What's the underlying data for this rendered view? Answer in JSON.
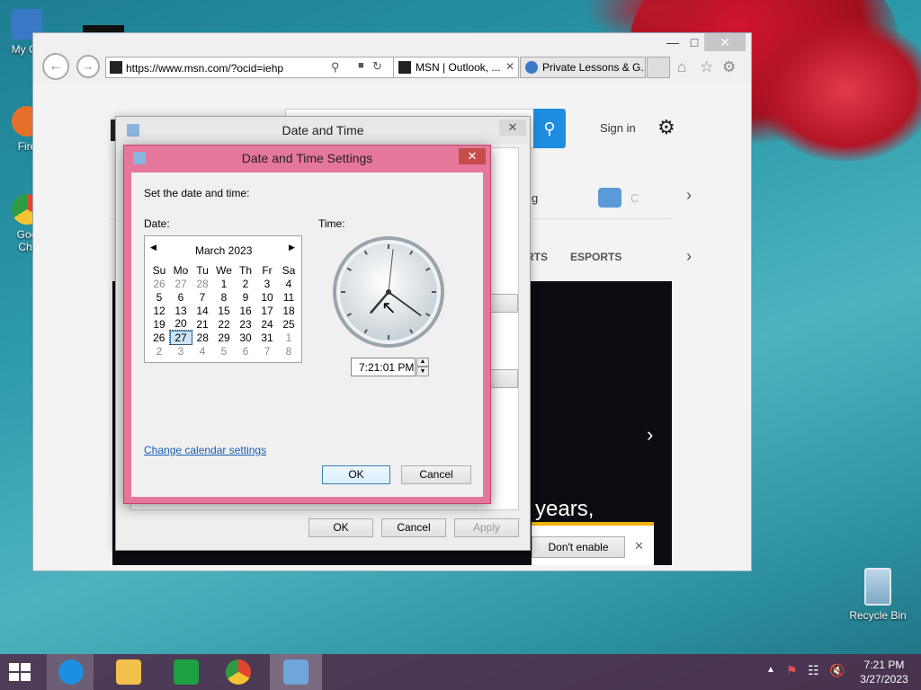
{
  "desktop": {
    "icons": [
      {
        "label": "My Co",
        "color": "#3a78c8"
      },
      {
        "label": "Fire",
        "color": "#e76f2a"
      },
      {
        "label": "Goo Chr",
        "color": "#2f9c44"
      }
    ],
    "recycle_bin": {
      "label": "Recycle Bin"
    }
  },
  "browser": {
    "url": "https://www.msn.com/?ocid=iehp",
    "tabs": [
      {
        "label": "MSN | Outlook, ...",
        "active": true
      },
      {
        "label": "Private Lessons & G...",
        "active": false
      }
    ],
    "page": {
      "sign_in": "Sign in",
      "nav_items": [
        "RTS",
        "ESPORTS"
      ],
      "partial_text": [
        "g",
        "C"
      ],
      "hero_text": "years,",
      "notification_button": "Don't enable"
    }
  },
  "dialog_outer": {
    "title": "Date and Time",
    "buttons": {
      "ok": "OK",
      "cancel": "Cancel",
      "apply": "Apply"
    }
  },
  "dialog_inner": {
    "title": "Date and Time Settings",
    "prompt": "Set the date and time:",
    "date_label": "Date:",
    "time_label": "Time:",
    "calendar": {
      "month": "March 2023",
      "weekdays": [
        "Su",
        "Mo",
        "Tu",
        "We",
        "Th",
        "Fr",
        "Sa"
      ],
      "weeks": [
        [
          "26",
          "27",
          "28",
          "1",
          "2",
          "3",
          "4"
        ],
        [
          "5",
          "6",
          "7",
          "8",
          "9",
          "10",
          "11"
        ],
        [
          "12",
          "13",
          "14",
          "15",
          "16",
          "17",
          "18"
        ],
        [
          "19",
          "20",
          "21",
          "22",
          "23",
          "24",
          "25"
        ],
        [
          "26",
          "27",
          "28",
          "29",
          "30",
          "31",
          "1"
        ],
        [
          "2",
          "3",
          "4",
          "5",
          "6",
          "7",
          "8"
        ]
      ],
      "selected_day": "27"
    },
    "clock": {
      "hour": 7,
      "minute": 21,
      "second": 1
    },
    "time_value": "7:21:01 PM",
    "change_calendar_link": "Change calendar settings",
    "buttons": {
      "ok": "OK",
      "cancel": "Cancel"
    }
  },
  "taskbar": {
    "apps": [
      {
        "name": "internet-explorer",
        "color": "#1b8fe0"
      },
      {
        "name": "file-explorer",
        "color": "#f2c04c"
      },
      {
        "name": "store",
        "color": "#1da043"
      },
      {
        "name": "chrome",
        "color": "#e3462f"
      },
      {
        "name": "date-time-control",
        "color": "#6fa5d8"
      }
    ],
    "clock_time": "7:21 PM",
    "clock_date": "3/27/2023"
  }
}
